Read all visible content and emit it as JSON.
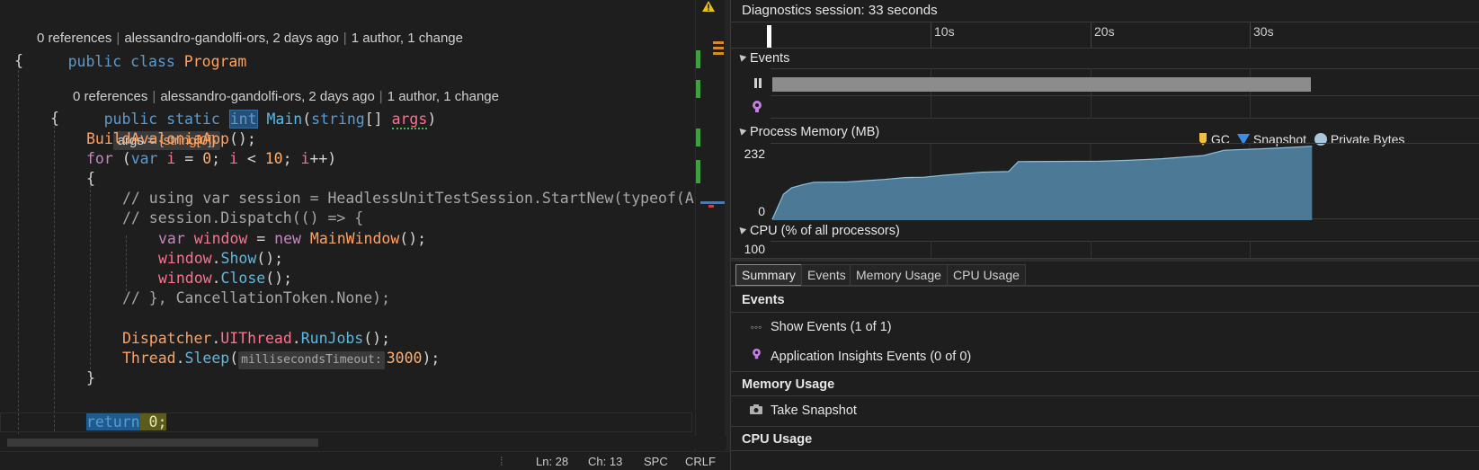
{
  "editor": {
    "class_lens": {
      "refs": "0 references",
      "author": "alessandro-gandolfi-ors, 2 days ago",
      "changes": "1 author, 1 change"
    },
    "method_lens": {
      "refs": "0 references",
      "author": "alessandro-gandolfi-ors, 2 days ago",
      "changes": "1 author, 1 change"
    },
    "code": {
      "class_decl": {
        "k1": "public",
        "k2": "class",
        "name": "Program"
      },
      "brace_open": "{",
      "main_decl": {
        "k1": "public",
        "k2": "static",
        "ret": "int",
        "name": "Main",
        "paren": "(",
        "ptype": "string",
        "brackets": "[] ",
        "pname": "args",
        "close": ")"
      },
      "args_hint": {
        "label": "args = ",
        "value": "{string[0]}"
      },
      "brace_open2": "{",
      "build": {
        "fn": "BuildAvaloniaApp",
        "rest": "();"
      },
      "for_line": {
        "kw": "for",
        "p1": " (",
        "kw2": "var",
        "v1": " i",
        "p2": " = ",
        "n0": "0",
        "p3": "; ",
        "v2": "i",
        "p4": " < ",
        "n10": "10",
        "p5": "; ",
        "v3": "i",
        "p6": "++)"
      },
      "brace_open3": "{",
      "c1": "// using var session = HeadlessUnitTestSession.StartNew(typeof(A",
      "c2": "// session.Dispatch(() => {",
      "win_new": {
        "kw": "var",
        "v": " window",
        "eq": " = ",
        "kw2": "new",
        "t": " MainWindow",
        "rest": "();"
      },
      "win_show": {
        "v": "window",
        "dot": ".",
        "m": "Show",
        "rest": "();"
      },
      "win_close": {
        "v": "window",
        "dot": ".",
        "m": "Close",
        "rest": "();"
      },
      "c3": "// }, CancellationToken.None);",
      "dispatch": {
        "t": "Dispatcher",
        "dot": ".",
        "p": "UIThread",
        "dot2": ".",
        "m": "RunJobs",
        "rest": "();"
      },
      "sleep": {
        "t": "Thread",
        "dot": ".",
        "m": "Sleep",
        "paren": "(",
        "hint": "millisecondsTimeout:",
        "n": "3000",
        "rest": ");"
      },
      "brace_close3": "}",
      "ret": {
        "kw": "return",
        "sp": " ",
        "n": "0",
        "semi": ";"
      }
    },
    "status": {
      "ln": "Ln: 28",
      "ch": "Ch: 13",
      "enc": "SPC",
      "eol": "CRLF"
    }
  },
  "diagnostics": {
    "title": "Diagnostics session: 33 seconds",
    "ruler_labels": [
      "10s",
      "20s",
      "30s"
    ],
    "events_header": "Events",
    "memory_header": "Process Memory (MB)",
    "legend": {
      "gc": "GC",
      "snapshot": "Snapshot",
      "private": "Private Bytes"
    },
    "mem_axis": {
      "max": "232",
      "min": "0"
    },
    "memory_series": {
      "unit": "MB",
      "range": [
        0,
        232
      ],
      "points": [
        [
          0.0,
          0
        ],
        [
          0.7,
          80
        ],
        [
          1.2,
          100
        ],
        [
          1.9,
          110
        ],
        [
          2.6,
          118
        ],
        [
          4.7,
          119
        ],
        [
          5.8,
          123
        ],
        [
          7.0,
          127
        ],
        [
          8.3,
          133
        ],
        [
          9.5,
          134
        ],
        [
          10.7,
          140
        ],
        [
          11.9,
          145
        ],
        [
          13.1,
          150
        ],
        [
          14.8,
          152
        ],
        [
          15.4,
          184
        ],
        [
          20.5,
          185
        ],
        [
          22.3,
          188
        ],
        [
          24.4,
          193
        ],
        [
          27.0,
          203
        ],
        [
          28.3,
          220
        ],
        [
          30.9,
          225
        ],
        [
          32.5,
          229
        ],
        [
          33.8,
          233
        ]
      ]
    },
    "cpu_header": "CPU (% of all processors)",
    "cpu_axis": {
      "max": "100"
    },
    "tabs": [
      "Summary",
      "Events",
      "Memory Usage",
      "CPU Usage"
    ],
    "summary": {
      "events_title": "Events",
      "show_events": "Show Events (1 of 1)",
      "app_insights": "Application Insights Events (0 of 0)",
      "memory_title": "Memory Usage",
      "take_snapshot": "Take Snapshot",
      "cpu_title": "CPU Usage"
    },
    "colors": {
      "memory_fill": "#4c7a96",
      "memory_line": "#8fbfda",
      "gc": "#f0c040",
      "snapshot": "#3a8ee6",
      "private": "#a8c6dc"
    }
  }
}
